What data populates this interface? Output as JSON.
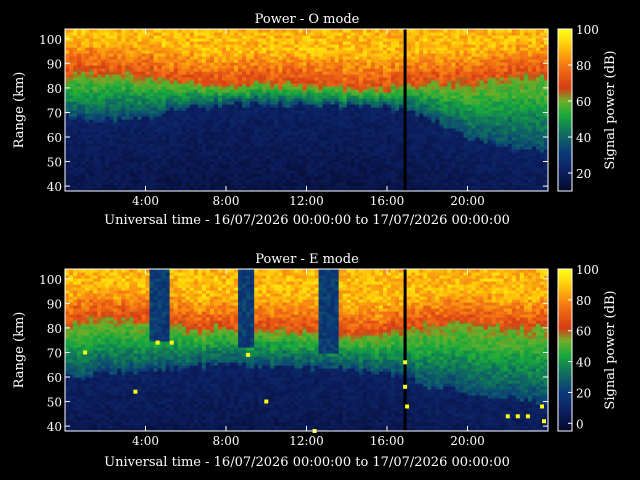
{
  "chart_data": [
    {
      "type": "heatmap",
      "title": "Power - O mode",
      "xlabel": "Universal time - 16/07/2026 00:00:00 to 17/07/2026 00:00:00",
      "ylabel": "Range (km)",
      "xlim": [
        0,
        24
      ],
      "ylim": [
        38,
        104
      ],
      "x_ticks": [
        4,
        8,
        12,
        16,
        20
      ],
      "x_tick_labels": [
        "4:00",
        "8:00",
        "12:00",
        "16:00",
        "20:00"
      ],
      "y_ticks": [
        40,
        50,
        60,
        70,
        80,
        90,
        100
      ],
      "colorbar": {
        "label": "Signal power (dB)",
        "range": [
          10,
          100
        ],
        "ticks": [
          20,
          40,
          60,
          80,
          100
        ]
      },
      "profile": {
        "hours": [
          0.5,
          2,
          4,
          6,
          8,
          10,
          12,
          14,
          16,
          17,
          18,
          20,
          22,
          23.5
        ],
        "green_top_km": [
          86,
          86,
          85,
          82,
          81,
          82,
          81,
          80,
          80,
          82,
          82,
          82,
          84,
          86
        ],
        "noise_top_km": [
          68,
          67,
          68,
          72,
          73,
          74,
          73,
          73,
          72,
          70,
          68,
          60,
          56,
          55
        ]
      },
      "gap_hour": 16.9
    },
    {
      "type": "heatmap",
      "title": "Power - E mode",
      "xlabel": "Universal time - 16/07/2026 00:00:00 to 17/07/2026 00:00:00",
      "ylabel": "Range (km)",
      "xlim": [
        0,
        24
      ],
      "ylim": [
        38,
        104
      ],
      "x_ticks": [
        4,
        8,
        12,
        16,
        20
      ],
      "x_tick_labels": [
        "4:00",
        "8:00",
        "12:00",
        "16:00",
        "20:00"
      ],
      "y_ticks": [
        40,
        50,
        60,
        70,
        80,
        90,
        100
      ],
      "colorbar": {
        "label": "Signal power (dB)",
        "range": [
          -5,
          100
        ],
        "ticks": [
          0,
          20,
          40,
          60,
          80,
          100
        ]
      },
      "profile": {
        "hours": [
          0.5,
          2,
          4,
          6,
          8,
          10,
          12,
          14,
          16,
          17,
          18,
          20,
          22,
          23.5
        ],
        "green_top_km": [
          82,
          84,
          83,
          80,
          80,
          80,
          79,
          78,
          78,
          80,
          82,
          82,
          80,
          80
        ],
        "noise_top_km": [
          60,
          62,
          63,
          64,
          65,
          64,
          64,
          63,
          62,
          60,
          56,
          54,
          52,
          50
        ]
      },
      "gap_hour": 16.9,
      "dropouts": [
        {
          "from_hour": 4.3,
          "to_hour": 5.1,
          "down_to_km": 75
        },
        {
          "from_hour": 8.7,
          "to_hour": 9.4,
          "down_to_km": 72
        },
        {
          "from_hour": 12.6,
          "to_hour": 13.6,
          "down_to_km": 70
        }
      ],
      "spikes": [
        {
          "hour": 1.0,
          "km": 70
        },
        {
          "hour": 3.5,
          "km": 54
        },
        {
          "hour": 4.6,
          "km": 74
        },
        {
          "hour": 5.3,
          "km": 74
        },
        {
          "hour": 9.1,
          "km": 69
        },
        {
          "hour": 10.0,
          "km": 50
        },
        {
          "hour": 12.4,
          "km": 38
        },
        {
          "hour": 16.9,
          "km": 66
        },
        {
          "hour": 16.9,
          "km": 56
        },
        {
          "hour": 17.0,
          "km": 48
        },
        {
          "hour": 22.0,
          "km": 44
        },
        {
          "hour": 22.5,
          "km": 44
        },
        {
          "hour": 23.0,
          "km": 44
        },
        {
          "hour": 23.7,
          "km": 48
        },
        {
          "hour": 23.8,
          "km": 42
        }
      ]
    }
  ]
}
